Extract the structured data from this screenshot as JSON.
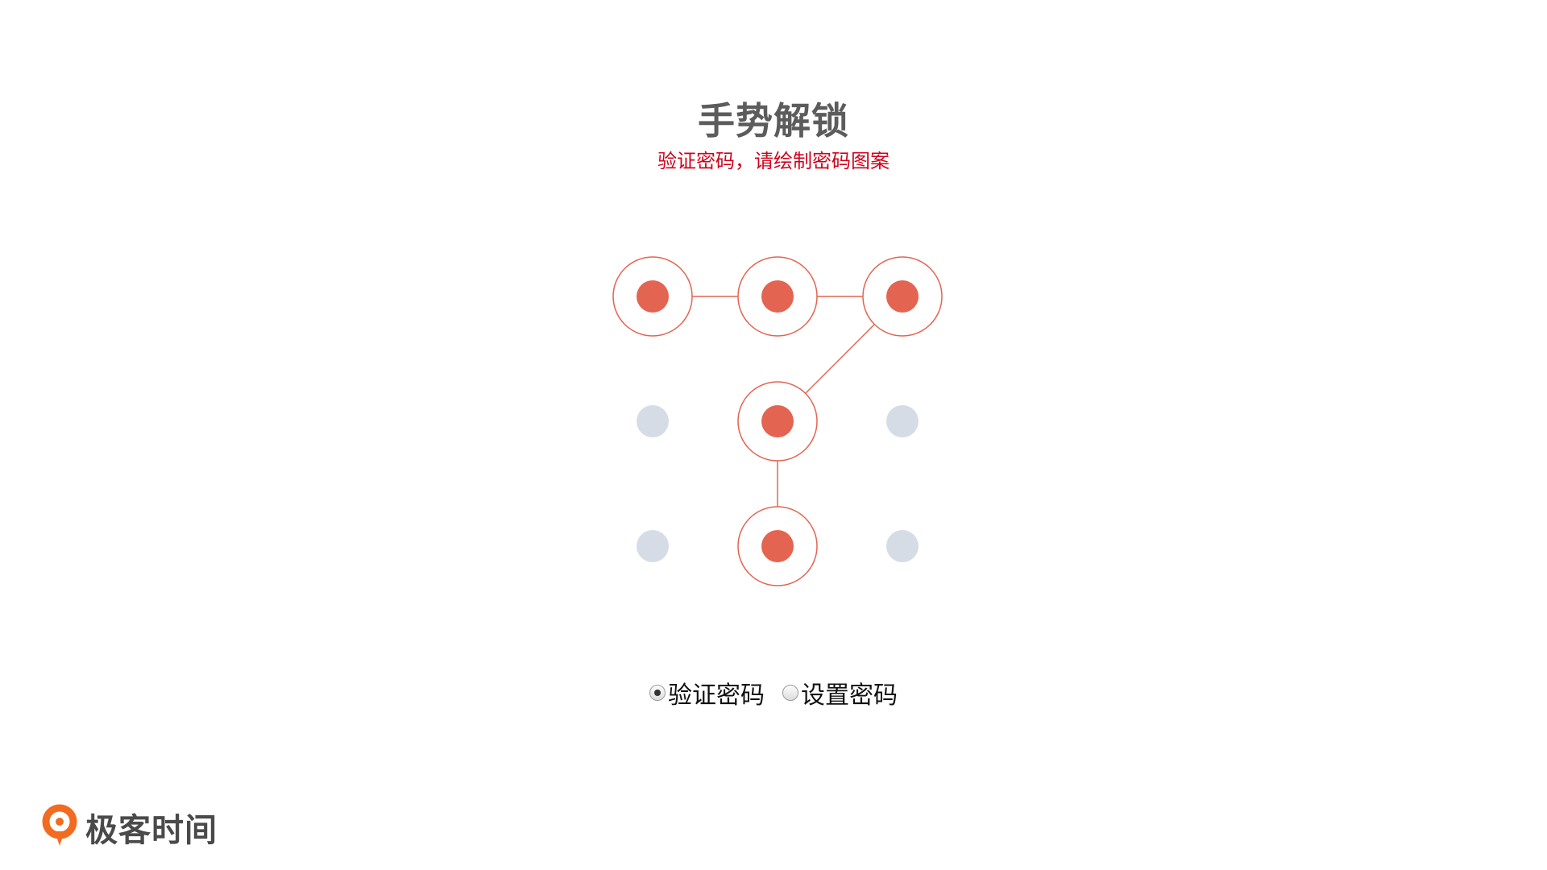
{
  "header": {
    "title": "手势解锁",
    "subtitle": "验证密码，请绘制密码图案"
  },
  "pattern": {
    "rows": 3,
    "cols": 3,
    "selected_sequence": [
      1,
      2,
      3,
      5,
      8
    ],
    "colors": {
      "selected_fill": "#e36450",
      "selected_ring": "#e36450",
      "line": "#e36450",
      "idle_fill": "#d6dce6"
    }
  },
  "mode": {
    "options": [
      {
        "label": "验证密码",
        "checked": true
      },
      {
        "label": "设置密码",
        "checked": false
      }
    ]
  },
  "brand": {
    "name": "极客时间",
    "icon": "geektime-logo-icon",
    "color": "#f26b21"
  }
}
